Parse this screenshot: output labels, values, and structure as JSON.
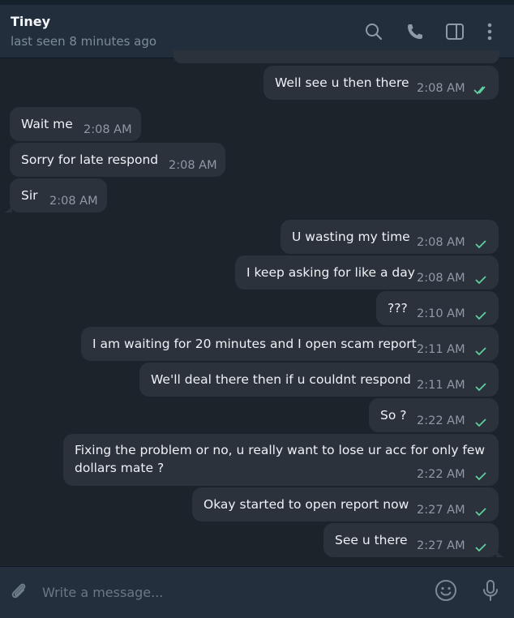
{
  "header": {
    "contact_name": "Tiney",
    "status": "last seen 8 minutes ago",
    "icons": [
      "search-icon",
      "phone-icon",
      "sidebar-toggle-icon",
      "more-vertical-icon"
    ]
  },
  "messages": [
    {
      "dir": "out",
      "text": "Well see u then there",
      "time": "2:08 AM",
      "status": "read"
    },
    {
      "dir": "in",
      "text": "Wait me",
      "time": "2:08 AM"
    },
    {
      "dir": "in",
      "text": "Sorry for late respond",
      "time": "2:08 AM"
    },
    {
      "dir": "in",
      "text": "Sir",
      "time": "2:08 AM"
    },
    {
      "dir": "out",
      "text": "U wasting my time",
      "time": "2:08 AM",
      "status": "sent"
    },
    {
      "dir": "out",
      "text": "I keep asking for like a day",
      "time": "2:08 AM",
      "status": "sent"
    },
    {
      "dir": "out",
      "text": "???",
      "time": "2:10 AM",
      "status": "sent"
    },
    {
      "dir": "out",
      "text": "I am waiting for 20 minutes and I open scam report",
      "time": "2:11 AM",
      "status": "sent"
    },
    {
      "dir": "out",
      "text": "We'll deal there then if u couldnt respond",
      "time": "2:11 AM",
      "status": "sent"
    },
    {
      "dir": "out",
      "text": "So ?",
      "time": "2:22 AM",
      "status": "sent"
    },
    {
      "dir": "out",
      "text_line1": "Fixing the problem or no, u really want to lose ur acc for only few",
      "text_line2": "dollars mate ?",
      "time": "2:22 AM",
      "status": "sent"
    },
    {
      "dir": "out",
      "text": "Okay started to open report now",
      "time": "2:27 AM",
      "status": "sent"
    },
    {
      "dir": "out",
      "text": "See u there",
      "time": "2:27 AM",
      "status": "sent"
    }
  ],
  "composer": {
    "placeholder": "Write a message...",
    "icons": [
      "attach-icon",
      "emoji-icon",
      "microphone-icon"
    ]
  },
  "colors": {
    "chat_bg": "#1d232b",
    "bubble": "#2b323b",
    "header_bg": "#232e3c",
    "check": "#5fcf9d"
  }
}
